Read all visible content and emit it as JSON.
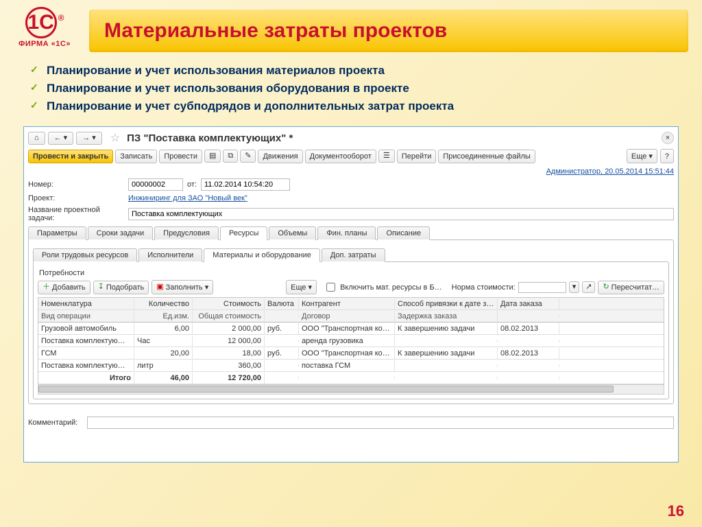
{
  "logo": {
    "main": "1С",
    "sub": "ФИРМА «1С»",
    "reg": "®"
  },
  "title": "Материальные затраты проектов",
  "bullets": [
    "Планирование и учет использования материалов проекта",
    "Планирование и учет использования оборудования в проекте",
    "Планирование и учет субподрядов и дополнительных затрат проекта"
  ],
  "nav": {
    "home": "⌂",
    "back": "←",
    "fwd": "→",
    "dd": "▾",
    "star": "☆"
  },
  "doc": {
    "title": "ПЗ \"Поставка комплектующих\" *",
    "close": "×"
  },
  "toolbar": {
    "post_close": "Провести и закрыть",
    "save": "Записать",
    "post": "Провести",
    "movements": "Движения",
    "docflow": "Документооборот",
    "goto": "Перейти",
    "attachments": "Присоединенные файлы",
    "more": "Еще ▾",
    "help": "?"
  },
  "meta_link": "Администратор, 20.05.2014 15:51:44",
  "form": {
    "number_label": "Номер:",
    "number": "00000002",
    "date_label": "от:",
    "date": "11.02.2014 10:54:20",
    "project_label": "Проект:",
    "project": "Инжиниринг для ЗАО \"Новый век\"",
    "taskname_label": "Название проектной задачи:",
    "taskname": "Поставка комплектующих"
  },
  "tabs": [
    "Параметры",
    "Сроки задачи",
    "Предусловия",
    "Ресурсы",
    "Объемы",
    "Фин. планы",
    "Описание"
  ],
  "active_tab": "Ресурсы",
  "subtabs": [
    "Роли трудовых ресурсов",
    "Исполнители",
    "Материалы и оборудование",
    "Доп. затраты"
  ],
  "active_subtab": "Материалы и оборудование",
  "section": "Потребности",
  "subtoolbar": {
    "add": "Добавить",
    "pick": "Подобрать",
    "fill": "Заполнить ▾",
    "more2": "Еще ▾",
    "include_label": "Включить мат. ресурсы в Б…",
    "norm_label": "Норма стоимости:",
    "recalc": "Пересчитат…"
  },
  "grid": {
    "h1": [
      "Номенклатура",
      "Количество",
      "Стоимость",
      "Валюта",
      "Контрагент",
      "Способ привязки к дате заказа",
      "Дата заказа"
    ],
    "h2": [
      "Вид операции",
      "Ед.изм.",
      "Общая стоимость",
      "",
      "Договор",
      "Задержка заказа",
      ""
    ],
    "rows": [
      [
        "Грузовой автомобиль",
        "6,00",
        "2 000,00",
        "руб.",
        "ООО \"Транспортная ко…",
        "К завершению задачи",
        "08.02.2013"
      ],
      [
        "Поставка комплектующи…",
        "Час",
        "12 000,00",
        "",
        "аренда грузовика",
        "",
        ""
      ],
      [
        "ГСМ",
        "20,00",
        "18,00",
        "руб.",
        "ООО \"Транспортная ко…",
        "К завершению задачи",
        "08.02.2013"
      ],
      [
        "Поставка комплектующи…",
        "литр",
        "360,00",
        "",
        "поставка ГСМ",
        "",
        ""
      ]
    ],
    "total": [
      "Итого",
      "46,00",
      "12 720,00",
      "",
      "",
      "",
      ""
    ]
  },
  "comment_label": "Комментарий:",
  "page_num": "16"
}
